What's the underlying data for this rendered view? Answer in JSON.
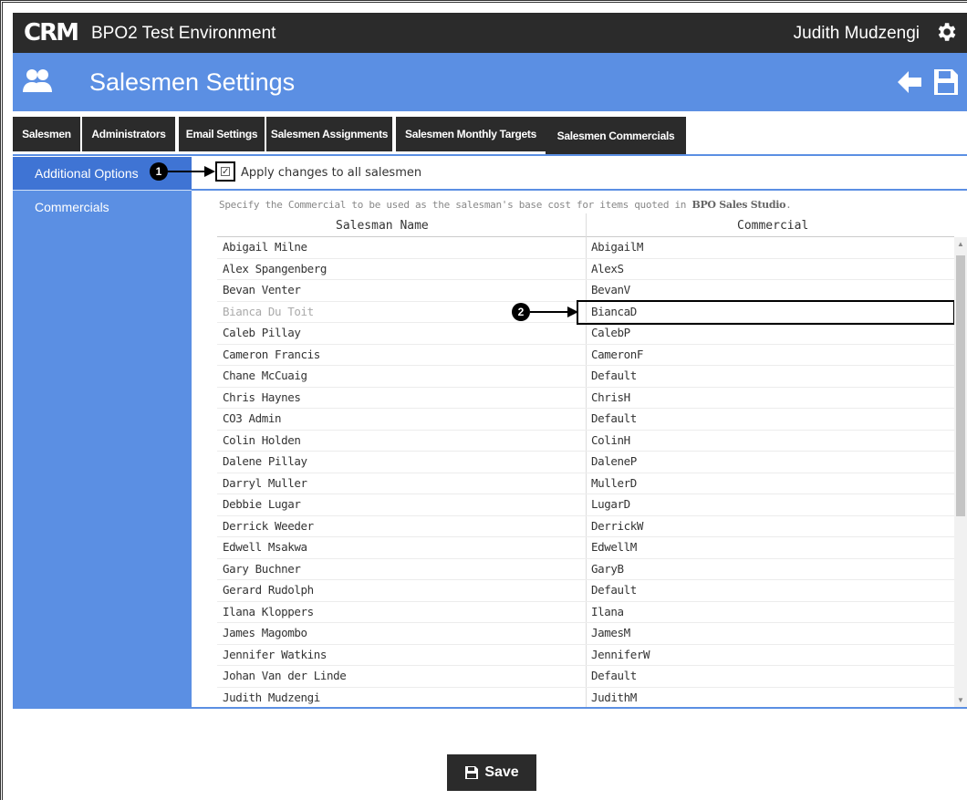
{
  "topbar": {
    "logo": "CRM",
    "app_title": "BPO2 Test Environment",
    "user_name": "Judith Mudzengi"
  },
  "header": {
    "title": "Salesmen Settings"
  },
  "tabs": [
    {
      "label": "Salesmen"
    },
    {
      "label": "Administrators"
    },
    {
      "label": "Email Settings"
    },
    {
      "label": "Salesmen Assignments"
    },
    {
      "label": "Salesmen Monthly Targets"
    },
    {
      "label": "Salesmen Commercials"
    }
  ],
  "sidebar": {
    "items": [
      {
        "label": "Additional Options"
      },
      {
        "label": "Commercials"
      }
    ]
  },
  "options": {
    "apply_all_label": "Apply changes to all salesmen",
    "apply_all_checked": true
  },
  "callouts": {
    "one": "1",
    "two": "2"
  },
  "description": {
    "text": "Specify the Commercial to be used as the salesman's base cost for items quoted in ",
    "product": "BPO Sales Studio",
    "suffix": "."
  },
  "table": {
    "headers": [
      "Salesman Name",
      "Commercial"
    ],
    "rows": [
      {
        "name": "Abigail Milne",
        "commercial": "AbigailM"
      },
      {
        "name": "Alex Spangenberg",
        "commercial": "AlexS"
      },
      {
        "name": "Bevan Venter",
        "commercial": "BevanV"
      },
      {
        "name": "Bianca Du Toit",
        "commercial": "BiancaD"
      },
      {
        "name": "Caleb Pillay",
        "commercial": "CalebP"
      },
      {
        "name": "Cameron Francis",
        "commercial": "CameronF"
      },
      {
        "name": "Chane McCuaig",
        "commercial": "Default"
      },
      {
        "name": "Chris Haynes",
        "commercial": "ChrisH"
      },
      {
        "name": "CO3 Admin",
        "commercial": "Default"
      },
      {
        "name": "Colin Holden",
        "commercial": "ColinH"
      },
      {
        "name": "Dalene Pillay",
        "commercial": "DaleneP"
      },
      {
        "name": "Darryl Muller",
        "commercial": "MullerD"
      },
      {
        "name": "Debbie Lugar",
        "commercial": "LugarD"
      },
      {
        "name": "Derrick Weeder",
        "commercial": "DerrickW"
      },
      {
        "name": "Edwell Msakwa",
        "commercial": "EdwellM"
      },
      {
        "name": "Gary Buchner",
        "commercial": "GaryB"
      },
      {
        "name": "Gerard Rudolph",
        "commercial": "Default"
      },
      {
        "name": "Ilana Kloppers",
        "commercial": "Ilana"
      },
      {
        "name": "James Magombo",
        "commercial": "JamesM"
      },
      {
        "name": "Jennifer Watkins",
        "commercial": "JenniferW"
      },
      {
        "name": "Johan Van der Linde",
        "commercial": "Default"
      },
      {
        "name": "Judith Mudzengi",
        "commercial": "JudithM"
      }
    ]
  },
  "footer": {
    "save_label": "Save"
  },
  "colors": {
    "primary": "#5b8fe3",
    "dark": "#2b2b2b",
    "sidebar_active": "#3f74d4"
  }
}
